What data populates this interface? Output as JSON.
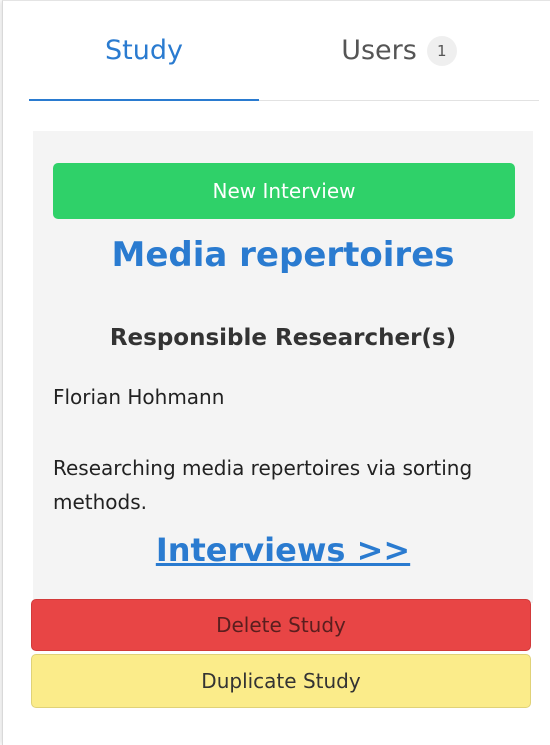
{
  "tabs": {
    "study_label": "Study",
    "users_label": "Users",
    "users_count": "1"
  },
  "study": {
    "new_interview_label": "New Interview",
    "title": "Media repertoires",
    "responsible_heading": "Responsible Researcher(s)",
    "researcher": "Florian Hohmann",
    "description": "Researching media repertoires via sorting methods.",
    "interviews_link": "Interviews >>"
  },
  "actions": {
    "delete_label": "Delete Study",
    "duplicate_label": "Duplicate Study"
  },
  "colors": {
    "accent_blue": "#2a7bd0",
    "new_interview_green": "#2fd169",
    "delete_red": "#e84545",
    "duplicate_yellow": "#fbec8a"
  }
}
